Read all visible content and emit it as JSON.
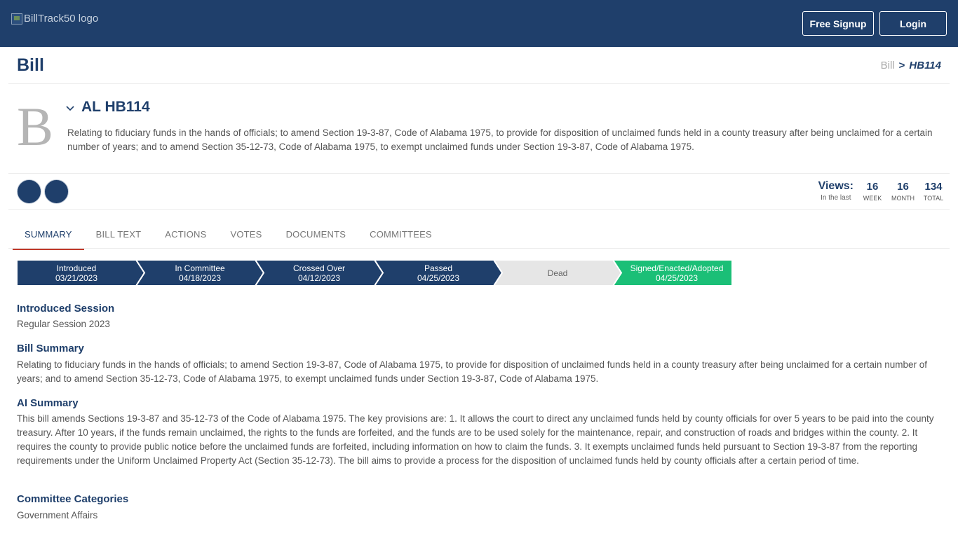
{
  "header": {
    "logo_alt": "BillTrack50 logo",
    "signup_label": "Free Signup",
    "login_label": "Login"
  },
  "page": {
    "title": "Bill",
    "breadcrumb": {
      "root": "Bill",
      "separator": ">",
      "current": "HB114"
    }
  },
  "bill": {
    "letter": "B",
    "id": "AL HB114",
    "description": "Relating to fiduciary funds in the hands of officials; to amend Section 19-3-87, Code of Alabama 1975, to provide for disposition of unclaimed funds held in a county treasury after being unclaimed for a certain number of years; and to amend Section 35-12-73, Code of Alabama 1975, to exempt unclaimed funds under Section 19-3-87, Code of Alabama 1975."
  },
  "actions": {
    "button1_icon": "",
    "button2_icon": ""
  },
  "views": {
    "label": "Views:",
    "sub": "In the last",
    "week": {
      "value": "16",
      "label": "WEEK"
    },
    "month": {
      "value": "16",
      "label": "MONTH"
    },
    "total": {
      "value": "134",
      "label": "TOTAL"
    }
  },
  "tabs": [
    {
      "label": "SUMMARY",
      "active": true
    },
    {
      "label": "BILL TEXT"
    },
    {
      "label": "ACTIONS"
    },
    {
      "label": "VOTES"
    },
    {
      "label": "DOCUMENTS"
    },
    {
      "label": "COMMITTEES"
    }
  ],
  "progress": [
    {
      "label": "Introduced",
      "date": "03/21/2023",
      "state": "done",
      "color": "#1f3f6b"
    },
    {
      "label": "In Committee",
      "date": "04/18/2023",
      "state": "done",
      "color": "#1f3f6b"
    },
    {
      "label": "Crossed Over",
      "date": "04/12/2023",
      "state": "done",
      "color": "#1f3f6b"
    },
    {
      "label": "Passed",
      "date": "04/25/2023",
      "state": "done",
      "color": "#1f3f6b"
    },
    {
      "label": "Dead",
      "date": "",
      "state": "inactive",
      "color": "#e6e6e6"
    },
    {
      "label": "Signed/Enacted/Adopted",
      "date": "04/25/2023",
      "state": "final",
      "color": "#1bbf77"
    }
  ],
  "sections": {
    "introduced_session": {
      "heading": "Introduced Session",
      "body": "Regular Session 2023"
    },
    "bill_summary": {
      "heading": "Bill Summary",
      "body": "Relating to fiduciary funds in the hands of officials; to amend Section 19-3-87, Code of Alabama 1975, to provide for disposition of unclaimed funds held in a county treasury after being unclaimed for a certain number of years; and to amend Section 35-12-73, Code of Alabama 1975, to exempt unclaimed funds under Section 19-3-87, Code of Alabama 1975."
    },
    "ai_summary": {
      "heading": "AI Summary",
      "body": "This bill amends Sections 19-3-87 and 35-12-73 of the Code of Alabama 1975. The key provisions are: 1. It allows the court to direct any unclaimed funds held by county officials for over 5 years to be paid into the county treasury. After 10 years, if the funds remain unclaimed, the rights to the funds are forfeited, and the funds are to be used solely for the maintenance, repair, and construction of roads and bridges within the county. 2. It requires the county to provide public notice before the unclaimed funds are forfeited, including information on how to claim the funds. 3. It exempts unclaimed funds held pursuant to Section 19-3-87 from the reporting requirements under the Uniform Unclaimed Property Act (Section 35-12-73). The bill aims to provide a process for the disposition of unclaimed funds held by county officials after a certain period of time."
    },
    "committee_categories": {
      "heading": "Committee Categories",
      "body": "Government Affairs"
    }
  }
}
